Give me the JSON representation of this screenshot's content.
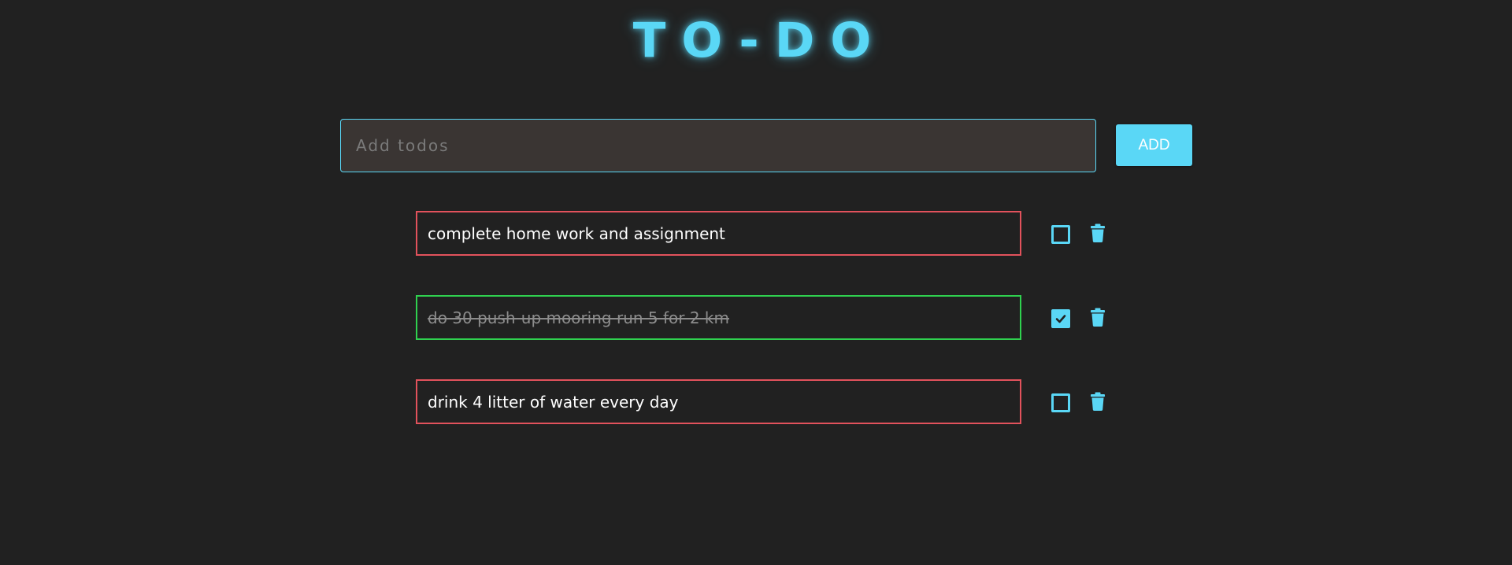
{
  "header": {
    "title": "TO-DO"
  },
  "add_form": {
    "input_value": "",
    "input_placeholder": "Add todos",
    "add_label": "ADD"
  },
  "todos": [
    {
      "text": "complete home work and assignment",
      "completed": false
    },
    {
      "text": "do 30 push-up mooring run 5 for 2 km",
      "completed": true
    },
    {
      "text": "drink 4 litter of water every day",
      "completed": false
    }
  ],
  "icons": {
    "checkbox": "checkbox-icon",
    "delete": "trash-icon"
  },
  "colors": {
    "background": "#212121",
    "accent": "#5ad7f6",
    "pending_border": "#e2525c",
    "done_border": "#2fd14f",
    "input_background": "#3a3533"
  }
}
